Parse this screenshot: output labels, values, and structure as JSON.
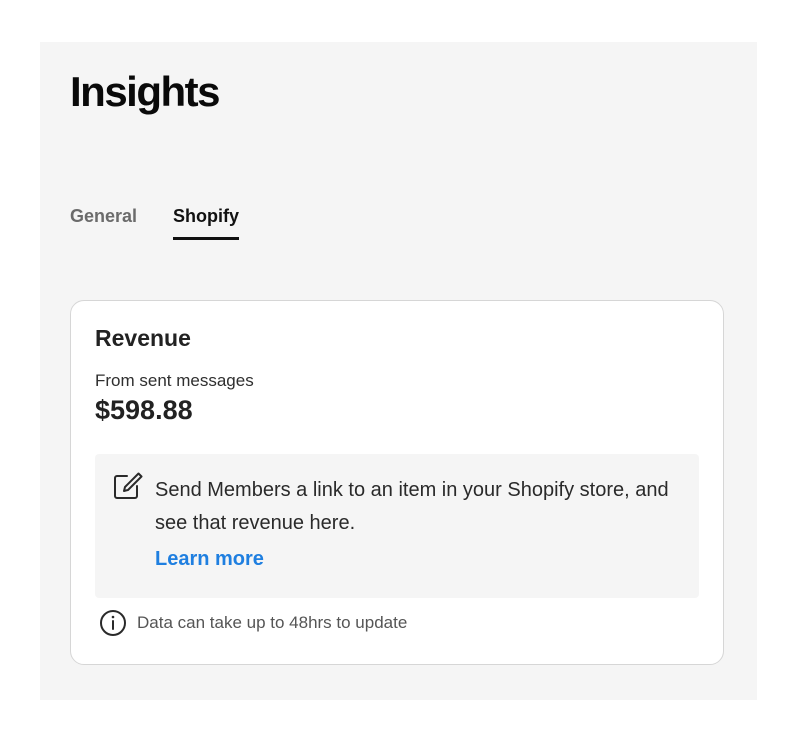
{
  "page": {
    "title": "Insights"
  },
  "tabs": [
    {
      "label": "General",
      "active": false
    },
    {
      "label": "Shopify",
      "active": true
    }
  ],
  "revenue_card": {
    "title": "Revenue",
    "subtitle": "From sent messages",
    "amount": "$598.88",
    "callout": {
      "icon": "edit-icon",
      "text": "Send Members a link to an item in your Shopify store, and see that revenue here.",
      "link_label": "Learn more"
    },
    "footnote": {
      "icon": "info-icon",
      "text": "Data can take up to 48hrs to update"
    }
  },
  "colors": {
    "panel_background": "#f5f5f5",
    "link": "#1f7fe0",
    "active_tab": "#111111",
    "inactive_tab": "#6b6b6b"
  }
}
